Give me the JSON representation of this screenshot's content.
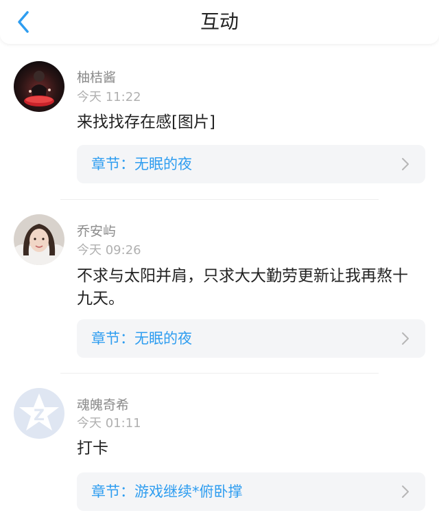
{
  "header": {
    "title": "互动"
  },
  "colors": {
    "accent": "#2e9df0",
    "card_bg": "#f4f5f7",
    "muted": "#8a8a8a"
  },
  "icons": {
    "back": "chevron-left-icon",
    "chapter_arrow": "chevron-right-icon"
  },
  "posts": [
    {
      "username": "柚桔酱",
      "time": "今天 11:22",
      "content": "来找找存在感[图片]",
      "chapter": "章节：无眠的夜"
    },
    {
      "username": "乔安屿",
      "time": "今天 09:26",
      "content": "不求与太阳并肩，只求大大勤劳更新让我再熬十九天。",
      "chapter": "章节：无眠的夜"
    },
    {
      "username": "魂魄奇希",
      "time": "今天 01:11",
      "content": "打卡",
      "chapter": "章节：游戏继续*俯卧撑"
    }
  ]
}
